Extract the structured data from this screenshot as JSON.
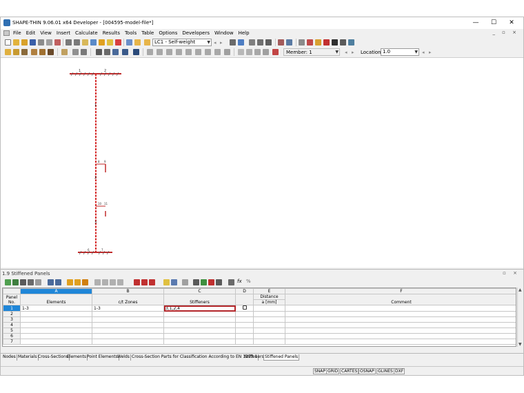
{
  "window": {
    "title": "SHAPE-THIN 9.06.01 x64 Developer - [004595-model-file*]",
    "controls": [
      "—",
      "☐",
      "✕"
    ]
  },
  "menu": [
    "File",
    "Edit",
    "View",
    "Insert",
    "Calculate",
    "Results",
    "Tools",
    "Table",
    "Options",
    "Developers",
    "Window",
    "Help"
  ],
  "toolbar": {
    "loadcase": "LC1 - Self-weight",
    "member_label": "Member: 1",
    "location_label": "Location:",
    "location_value": "1.0"
  },
  "model": {
    "node_labels": [
      "1",
      "2",
      "3",
      "4",
      "5",
      "6",
      "7",
      "8",
      "9",
      "10",
      "11"
    ],
    "element_labels": [
      "1",
      "2",
      "3"
    ]
  },
  "panel": {
    "title": "1.9 Stiffened Panels",
    "columns": [
      "A",
      "B",
      "C",
      "D",
      "E",
      "F"
    ],
    "headers": {
      "panel_no": "Panel No.",
      "elements": "Elements",
      "ct_zones": "c/t Zones",
      "stiffeners": "Stiffeners",
      "distance": "Distance",
      "distance_unit": "a [mm]",
      "comment": "Comment"
    },
    "rows": [
      {
        "no": "1",
        "elements": "1-3",
        "ct_zones": "1-3",
        "stiffeners": "3,1,2,4",
        "checkbox": true,
        "distance": "",
        "comment": ""
      },
      {
        "no": "2",
        "elements": "",
        "ct_zones": "",
        "stiffeners": "",
        "checkbox": false,
        "distance": "",
        "comment": ""
      },
      {
        "no": "3",
        "elements": "",
        "ct_zones": "",
        "stiffeners": "",
        "checkbox": false,
        "distance": "",
        "comment": ""
      },
      {
        "no": "4",
        "elements": "",
        "ct_zones": "",
        "stiffeners": "",
        "checkbox": false,
        "distance": "",
        "comment": ""
      },
      {
        "no": "5",
        "elements": "",
        "ct_zones": "",
        "stiffeners": "",
        "checkbox": false,
        "distance": "",
        "comment": ""
      },
      {
        "no": "6",
        "elements": "",
        "ct_zones": "",
        "stiffeners": "",
        "checkbox": false,
        "distance": "",
        "comment": ""
      },
      {
        "no": "7",
        "elements": "",
        "ct_zones": "",
        "stiffeners": "",
        "checkbox": false,
        "distance": "",
        "comment": ""
      }
    ]
  },
  "tabs": [
    "Nodes",
    "Materials",
    "Cross-Sections",
    "Elements",
    "Point Elements",
    "Welds",
    "Cross-Section Parts for Classification According to EN 1993-1",
    "Stiffeners",
    "Stiffened Panels"
  ],
  "active_tab": "Stiffened Panels",
  "status": [
    "SNAP",
    "GRID",
    "CARTES",
    "OSNAP",
    "GLINES",
    "DXF"
  ],
  "colors": {
    "accent": "#1f86d8",
    "highlight": "#b3262a",
    "member": "#d42a2a"
  }
}
